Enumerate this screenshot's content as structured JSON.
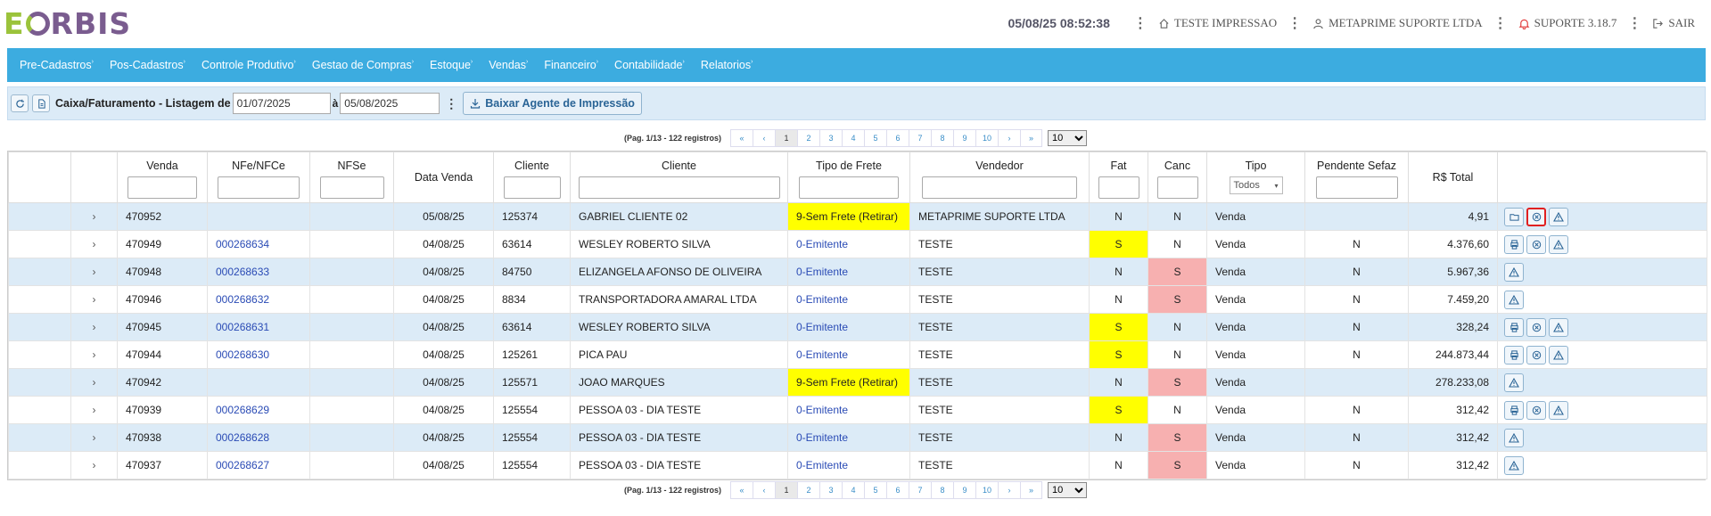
{
  "header": {
    "logo_text": "EORBIS",
    "datetime": "05/08/25 08:52:38",
    "store": "TESTE IMPRESSAO",
    "user": "METAPRIME SUPORTE LTDA",
    "support": "SUPORTE 3.18.7",
    "logout": "SAIR"
  },
  "nav": [
    {
      "label": "Pre-Cadastros"
    },
    {
      "label": "Pos-Cadastros"
    },
    {
      "label": "Controle Produtivo"
    },
    {
      "label": "Gestao de Compras"
    },
    {
      "label": "Estoque"
    },
    {
      "label": "Vendas"
    },
    {
      "label": "Financeiro"
    },
    {
      "label": "Contabilidade"
    },
    {
      "label": "Relatorios"
    }
  ],
  "toolbar": {
    "title": "Caixa/Faturamento - Listagem de",
    "date_from": "01/07/2025",
    "date_sep": "à",
    "date_to": "05/08/2025",
    "download_label": "Baixar Agente de Impressão"
  },
  "pager": {
    "info": "(Pag. 1/13 - 122 registros)",
    "first": "«",
    "prev": "‹",
    "next": "›",
    "last": "»",
    "pages": [
      "1",
      "2",
      "3",
      "4",
      "5",
      "6",
      "7",
      "8",
      "9",
      "10"
    ],
    "active_page": "1",
    "page_size": "10"
  },
  "table": {
    "columns": [
      "",
      "",
      "Venda",
      "NFe/NFCe",
      "NFSe",
      "Data Venda",
      "Cliente",
      "Cliente",
      "Tipo de Frete",
      "Vendedor",
      "Fat",
      "Canc",
      "Tipo",
      "Pendente Sefaz",
      "R$ Total",
      ""
    ],
    "tipo_filter": "Todos",
    "rows": [
      {
        "venda": "470952",
        "nfe": "",
        "nfse": "",
        "data": "05/08/25",
        "cod": "125374",
        "cliente": "GABRIEL CLIENTE 02",
        "frete": "9-Sem Frete (Retirar)",
        "vendedor": "METAPRIME SUPORTE LTDA",
        "fat": "N",
        "canc": "N",
        "tipo": "Venda",
        "pend": "",
        "total": "4,91",
        "actions": [
          "folder",
          "cancel-hl",
          "warn"
        ]
      },
      {
        "venda": "470949",
        "nfe": "000268634",
        "nfse": "",
        "data": "04/08/25",
        "cod": "63614",
        "cliente": "WESLEY ROBERTO SILVA",
        "frete": "0-Emitente",
        "vendedor": "TESTE",
        "fat": "S",
        "canc": "N",
        "tipo": "Venda",
        "pend": "N",
        "total": "4.376,60",
        "actions": [
          "print",
          "cancel",
          "warn"
        ]
      },
      {
        "venda": "470948",
        "nfe": "000268633",
        "nfse": "",
        "data": "04/08/25",
        "cod": "84750",
        "cliente": "ELIZANGELA AFONSO DE OLIVEIRA",
        "frete": "0-Emitente",
        "vendedor": "TESTE",
        "fat": "N",
        "canc": "S",
        "tipo": "Venda",
        "pend": "N",
        "total": "5.967,36",
        "actions": [
          "warn"
        ]
      },
      {
        "venda": "470946",
        "nfe": "000268632",
        "nfse": "",
        "data": "04/08/25",
        "cod": "8834",
        "cliente": "TRANSPORTADORA AMARAL LTDA",
        "frete": "0-Emitente",
        "vendedor": "TESTE",
        "fat": "N",
        "canc": "S",
        "tipo": "Venda",
        "pend": "N",
        "total": "7.459,20",
        "actions": [
          "warn"
        ]
      },
      {
        "venda": "470945",
        "nfe": "000268631",
        "nfse": "",
        "data": "04/08/25",
        "cod": "63614",
        "cliente": "WESLEY ROBERTO SILVA",
        "frete": "0-Emitente",
        "vendedor": "TESTE",
        "fat": "S",
        "canc": "N",
        "tipo": "Venda",
        "pend": "N",
        "total": "328,24",
        "actions": [
          "print",
          "cancel",
          "warn"
        ]
      },
      {
        "venda": "470944",
        "nfe": "000268630",
        "nfse": "",
        "data": "04/08/25",
        "cod": "125261",
        "cliente": "PICA PAU",
        "frete": "0-Emitente",
        "vendedor": "TESTE",
        "fat": "S",
        "canc": "N",
        "tipo": "Venda",
        "pend": "N",
        "total": "244.873,44",
        "actions": [
          "print",
          "cancel",
          "warn"
        ]
      },
      {
        "venda": "470942",
        "nfe": "",
        "nfse": "",
        "data": "04/08/25",
        "cod": "125571",
        "cliente": "JOAO MARQUES",
        "frete": "9-Sem Frete (Retirar)",
        "vendedor": "TESTE",
        "fat": "N",
        "canc": "S",
        "tipo": "Venda",
        "pend": "",
        "total": "278.233,08",
        "actions": [
          "warn"
        ]
      },
      {
        "venda": "470939",
        "nfe": "000268629",
        "nfse": "",
        "data": "04/08/25",
        "cod": "125554",
        "cliente": "PESSOA 03 - DIA TESTE",
        "frete": "0-Emitente",
        "vendedor": "TESTE",
        "fat": "S",
        "canc": "N",
        "tipo": "Venda",
        "pend": "N",
        "total": "312,42",
        "actions": [
          "print",
          "cancel",
          "warn"
        ]
      },
      {
        "venda": "470938",
        "nfe": "000268628",
        "nfse": "",
        "data": "04/08/25",
        "cod": "125554",
        "cliente": "PESSOA 03 - DIA TESTE",
        "frete": "0-Emitente",
        "vendedor": "TESTE",
        "fat": "N",
        "canc": "S",
        "tipo": "Venda",
        "pend": "N",
        "total": "312,42",
        "actions": [
          "warn"
        ]
      },
      {
        "venda": "470937",
        "nfe": "000268627",
        "nfse": "",
        "data": "04/08/25",
        "cod": "125554",
        "cliente": "PESSOA 03 - DIA TESTE",
        "frete": "0-Emitente",
        "vendedor": "TESTE",
        "fat": "N",
        "canc": "S",
        "tipo": "Venda",
        "pend": "N",
        "total": "312,42",
        "actions": [
          "warn"
        ]
      }
    ]
  },
  "colors": {
    "nav_bg": "#3cace0",
    "row_alt": "#dcebf7",
    "yellow": "#ffff00",
    "pink": "#f7b0b0",
    "link": "#2a4bb5"
  }
}
